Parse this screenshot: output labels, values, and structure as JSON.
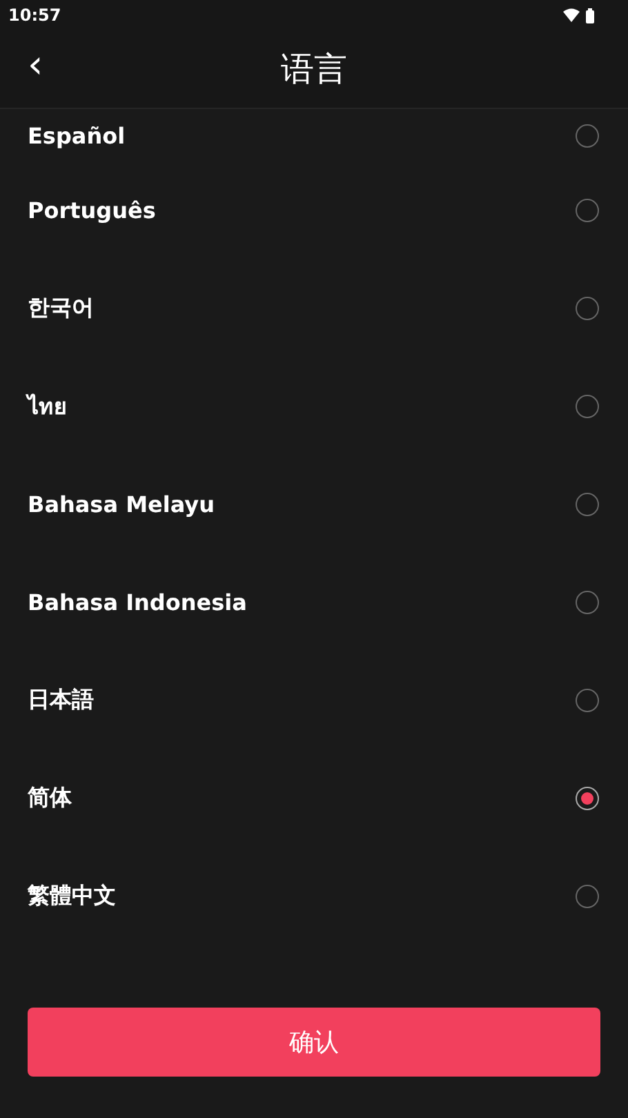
{
  "status_bar": {
    "time": "10:57"
  },
  "header": {
    "back": "‹",
    "title": "语言"
  },
  "languages": [
    {
      "label": "Español",
      "selected": false
    },
    {
      "label": "Português",
      "selected": false
    },
    {
      "label": "한국어",
      "selected": false
    },
    {
      "label": "ไทย",
      "selected": false
    },
    {
      "label": "Bahasa Melayu",
      "selected": false
    },
    {
      "label": "Bahasa Indonesia",
      "selected": false
    },
    {
      "label": "日本語",
      "selected": false
    },
    {
      "label": "简体",
      "selected": true
    },
    {
      "label": "繁體中文",
      "selected": false
    }
  ],
  "confirm_button": "确认"
}
